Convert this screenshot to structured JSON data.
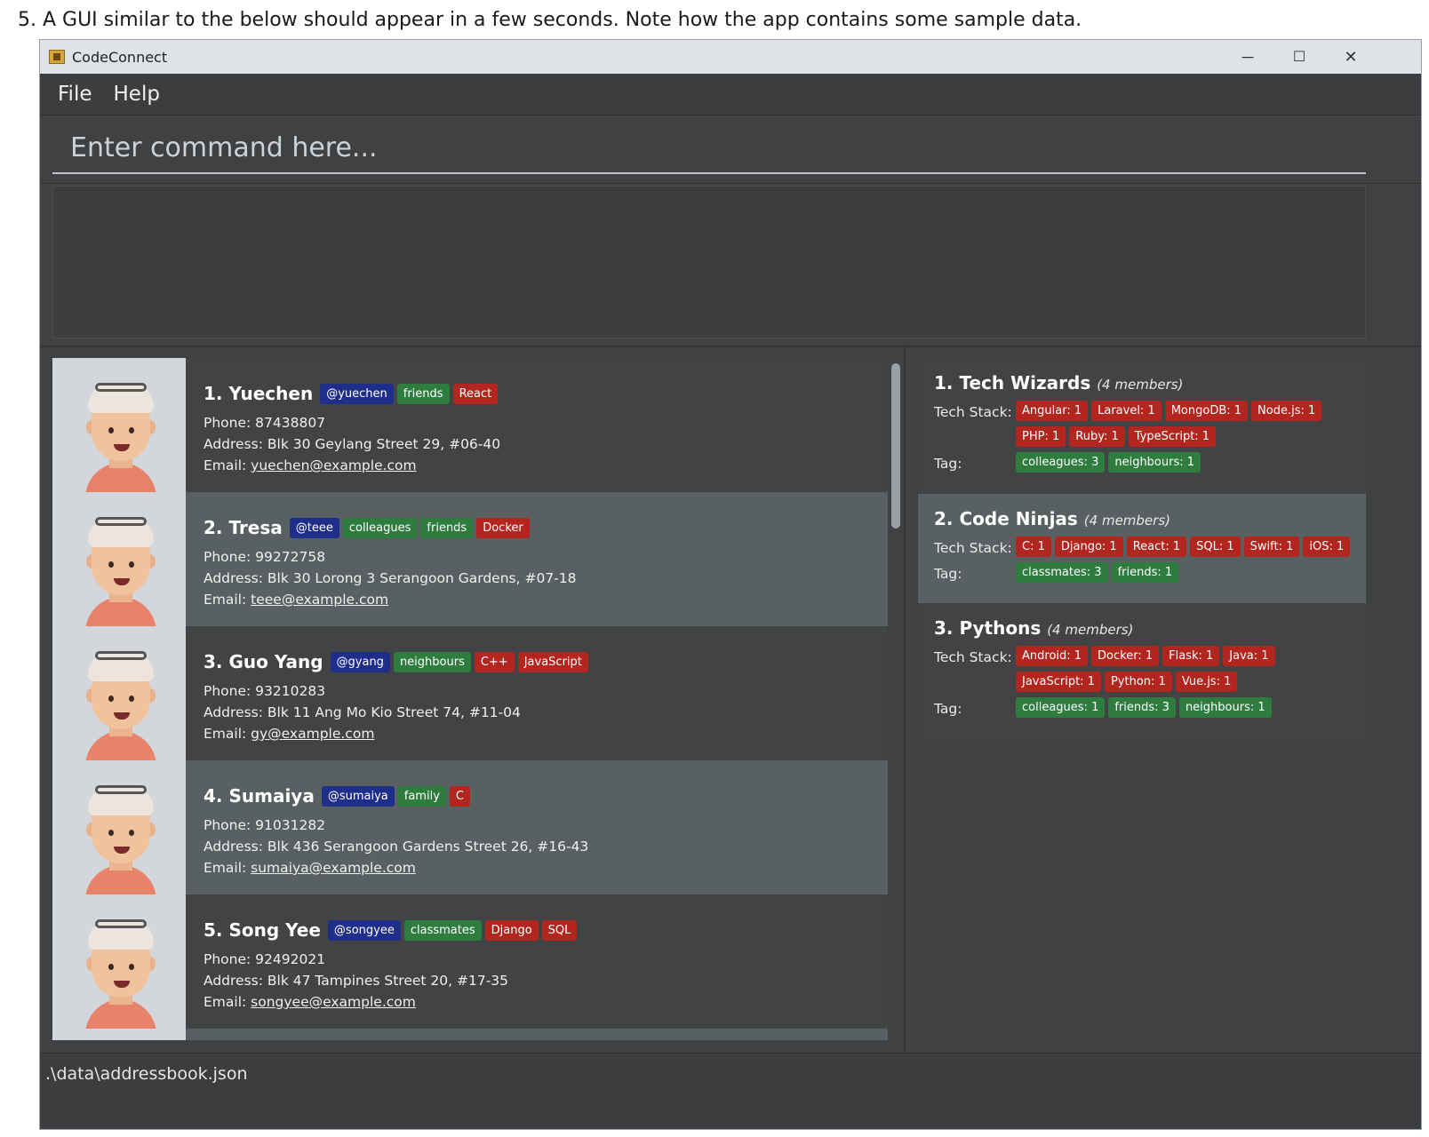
{
  "instruction": "5. A GUI similar to the below should appear in a few seconds. Note how the app contains some sample data.",
  "window": {
    "title": "CodeConnect",
    "minimize": "─",
    "maximize": "☐",
    "close": "✕"
  },
  "menu": {
    "file": "File",
    "help": "Help"
  },
  "command": {
    "placeholder": "Enter command here..."
  },
  "persons": [
    {
      "name": "1. Yuechen",
      "handle": "@yuechen",
      "tags": [
        "friends"
      ],
      "tech": [
        "React"
      ],
      "phone": "Phone: 87438807",
      "address": "Address: Blk 30 Geylang Street 29, #06-40",
      "email_label": "Email: ",
      "email": "yuechen@example.com"
    },
    {
      "name": "2. Tresa",
      "handle": "@teee",
      "tags": [
        "colleagues",
        "friends"
      ],
      "tech": [
        "Docker"
      ],
      "phone": "Phone: 99272758",
      "address": "Address: Blk 30 Lorong 3 Serangoon Gardens, #07-18",
      "email_label": "Email: ",
      "email": "teee@example.com"
    },
    {
      "name": "3. Guo Yang",
      "handle": "@gyang",
      "tags": [
        "neighbours"
      ],
      "tech": [
        "C++",
        "JavaScript"
      ],
      "phone": "Phone: 93210283",
      "address": "Address: Blk 11 Ang Mo Kio Street 74, #11-04",
      "email_label": "Email: ",
      "email": "gy@example.com"
    },
    {
      "name": "4. Sumaiya",
      "handle": "@sumaiya",
      "tags": [
        "family"
      ],
      "tech": [
        "C"
      ],
      "phone": "Phone: 91031282",
      "address": "Address: Blk 436 Serangoon Gardens Street 26, #16-43",
      "email_label": "Email: ",
      "email": "sumaiya@example.com"
    },
    {
      "name": "5. Song Yee",
      "handle": "@songyee",
      "tags": [
        "classmates"
      ],
      "tech": [
        "Django",
        "SQL"
      ],
      "phone": "Phone: 92492021",
      "address": "Address: Blk 47 Tampines Street 20, #17-35",
      "email_label": "Email: ",
      "email": "songyee@example.com"
    }
  ],
  "groups": [
    {
      "title": "1. Tech Wizards",
      "members": "(4 members)",
      "tech_label": "Tech Stack:",
      "tech": [
        "Angular: 1",
        "Laravel: 1",
        "MongoDB: 1",
        "Node.js: 1",
        "PHP: 1",
        "Ruby: 1",
        "TypeScript: 1"
      ],
      "tag_label": "Tag:",
      "tags": [
        "colleagues: 3",
        "neighbours: 1"
      ]
    },
    {
      "title": "2. Code Ninjas",
      "members": "(4 members)",
      "tech_label": "Tech Stack:",
      "tech": [
        "C: 1",
        "Django: 1",
        "React: 1",
        "SQL: 1",
        "Swift: 1",
        "iOS: 1"
      ],
      "tag_label": "Tag:",
      "tags": [
        "classmates: 3",
        "friends: 1"
      ]
    },
    {
      "title": "3. Pythons",
      "members": "(4 members)",
      "tech_label": "Tech Stack:",
      "tech": [
        "Android: 1",
        "Docker: 1",
        "Flask: 1",
        "Java: 1",
        "JavaScript: 1",
        "Python: 1",
        "Vue.js: 1"
      ],
      "tag_label": "Tag:",
      "tags": [
        "colleagues: 1",
        "friends: 3",
        "neighbours: 1"
      ]
    }
  ],
  "status": {
    "path": ".\\data\\addressbook.json"
  },
  "colors": {
    "handle": "#1f2e8a",
    "tag": "#2e7d3e",
    "tech": "#b3251f"
  }
}
